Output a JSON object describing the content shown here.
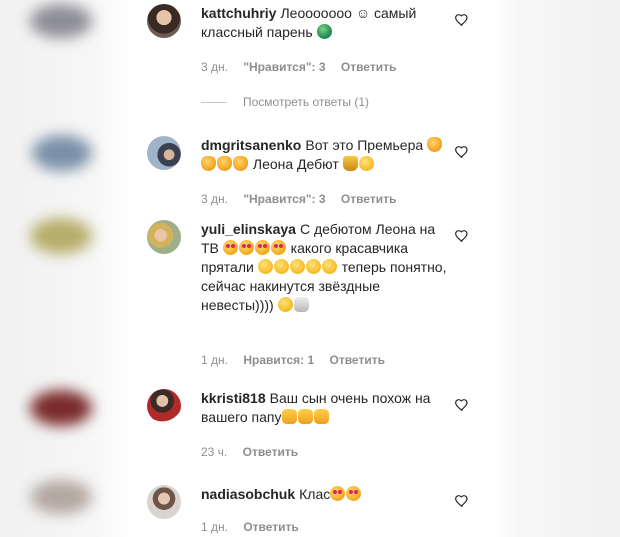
{
  "colors": {
    "text": "#262626",
    "muted": "#8e8e8e",
    "background": "#ffffff"
  },
  "comments": [
    {
      "username": "kattchuhriy",
      "text": "Леоооoooo ☺ самый классный парень",
      "emoji": [
        "globe"
      ],
      "time": "3 дн.",
      "likes": "\"Нравится\": 3",
      "reply": "Ответить"
    },
    {
      "username": "dmgritsanenko",
      "text": "Вот это Премьера",
      "emoji_mid": [
        "clapping-hands",
        "clapping-hands",
        "clapping-hands",
        "clapping-hands"
      ],
      "text2": "Леона Дебют",
      "emoji": [
        "trophy",
        "winking-face"
      ],
      "time": "3 дн.",
      "likes": "\"Нравится\": 3",
      "reply": "Ответить"
    },
    {
      "username": "yuli_elinskaya",
      "text": "С дебютом Леона на ТВ",
      "emoji_mid": [
        "heart-eyes",
        "heart-eyes",
        "heart-eyes",
        "heart-eyes"
      ],
      "text2": "какого красавчика прятали",
      "emoji_mid2": [
        "smiling-face",
        "smiling-face",
        "smiling-face",
        "smiling-face",
        "smiling-face"
      ],
      "text3": "теперь понятно, сейчас накинутся звёздные невесты))))",
      "emoji": [
        "smiling-face",
        "rabbit"
      ],
      "time": "1 дн.",
      "likes": "Нравится: 1",
      "reply": "Ответить"
    },
    {
      "username": "kkristi818",
      "text": "Ваш сын очень похож на вашего папу",
      "emoji": [
        "thumbs-up",
        "thumbs-up",
        "thumbs-up"
      ],
      "time": "23 ч.",
      "reply": "Ответить"
    },
    {
      "username": "nadiasobchuk",
      "text": "Клас",
      "emoji": [
        "heart-eyes",
        "heart-eyes"
      ],
      "time": "1 дн.",
      "reply": "Ответить"
    }
  ],
  "view_replies": "Посмотреть ответы (1)",
  "icons": {
    "like": "heart-outline-icon"
  }
}
